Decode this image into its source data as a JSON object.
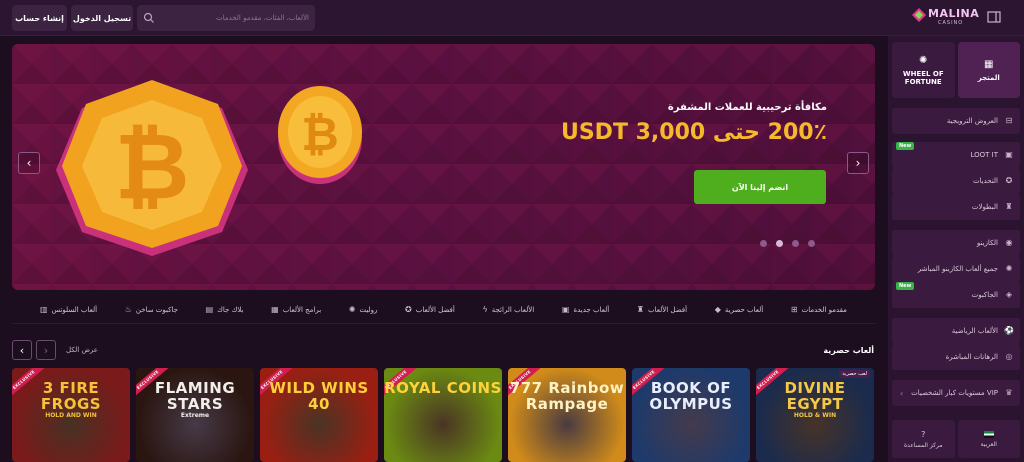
{
  "header": {
    "signup_label": "إنشاء حساب",
    "login_label": "تسجيل الدخول",
    "search_placeholder": "الألعاب، الفئات، مقدمو الخدمات",
    "logo_text": "MALINA",
    "logo_sub": "CASINO"
  },
  "banner": {
    "title": "مكافأة ترحيبية للعملات المشفرة",
    "amount": "200٪ حتى 3,000 USDT",
    "cta_label": "انضم إلينا الآن",
    "slides": 4,
    "active_slide": 3
  },
  "categories": [
    {
      "label": "مقدمو الخدمات",
      "icon": "grid-icon"
    },
    {
      "label": "ألعاب حصرية",
      "icon": "diamond-icon"
    },
    {
      "label": "أفضل الألعاب",
      "icon": "trophy-icon"
    },
    {
      "label": "ألعاب جديدة",
      "icon": "new-icon"
    },
    {
      "label": "الألعاب الرائجة",
      "icon": "bolt-icon"
    },
    {
      "label": "أفضل الألعاب",
      "icon": "star-icon"
    },
    {
      "label": "روليت",
      "icon": "roulette-icon"
    },
    {
      "label": "برامج الألعاب",
      "icon": "tv-icon"
    },
    {
      "label": "بلاك جاك",
      "icon": "cards-icon"
    },
    {
      "label": "جاكبوت ساخن",
      "icon": "fire-icon"
    },
    {
      "label": "ألعاب السلوتس",
      "icon": "slot-icon"
    }
  ],
  "section": {
    "title": "ألعاب حصرية",
    "view_all": "عرض الكل"
  },
  "games": [
    {
      "title": "3 FIRE FROGS",
      "sub": "HOLD AND WIN",
      "ribbon": "EXCLUSIVE",
      "bg": "#7a1a1a",
      "color": "#f6c23a"
    },
    {
      "title": "FLAMING STARS",
      "sub": "Extreme",
      "ribbon": "EXCLUSIVE",
      "bg": "#2a1510",
      "color": "#f2efe9"
    },
    {
      "title": "WILD WINS 40",
      "sub": "",
      "ribbon": "EXCLUSIVE",
      "bg": "#9a1f12",
      "color": "#ffcf3a"
    },
    {
      "title": "ROYAL COINS",
      "sub": "",
      "ribbon": "EXCLUSIVE",
      "bg": "#6b8a12",
      "color": "#ffd23a"
    },
    {
      "title": "777 Rainbow Rampage",
      "sub": "",
      "ribbon": "EXCLUSIVE",
      "bg": "#d08b1a",
      "color": "#fff3c4"
    },
    {
      "title": "BOOK OF OLYMPUS",
      "sub": "",
      "ribbon": "EXCLUSIVE",
      "bg": "#1e3a6b",
      "color": "#e8eefc"
    },
    {
      "title": "DIVINE EGYPT",
      "sub": "HOLD & WIN",
      "ribbon": "EXCLUSIVE",
      "badge": "لعب حصرية",
      "bg": "#1a2b4d",
      "color": "#f4c84a"
    }
  ],
  "sidebar": {
    "top_cards": [
      {
        "label": "WHEEL OF FORTUNE",
        "icon": "wheel-icon"
      },
      {
        "label": "المتجر",
        "icon": "shop-icon"
      }
    ],
    "items": [
      {
        "label": "العروض الترويجية",
        "icon": "gift-icon"
      },
      {
        "label": "LOOT IT",
        "icon": "bag-icon",
        "new": "New"
      },
      {
        "label": "التحديات",
        "icon": "medal-icon"
      },
      {
        "label": "البطولات",
        "icon": "cup-icon"
      },
      {
        "label": "الكازينو",
        "icon": "casino-chip-icon"
      },
      {
        "label": "جميع ألعاب الكازينو المباشر",
        "icon": "live-casino-icon"
      },
      {
        "label": "الجاكبوت",
        "icon": "jackpot-icon",
        "new": "New"
      },
      {
        "label": "الألعاب الرياضية",
        "icon": "sports-icon"
      },
      {
        "label": "الرهانات المباشرة",
        "icon": "live-bets-icon"
      },
      {
        "label": "مستويات كبار الشخصيات VIP",
        "icon": "vip-icon"
      }
    ],
    "language": "العربية",
    "help_label": "مركز المساعدة"
  }
}
